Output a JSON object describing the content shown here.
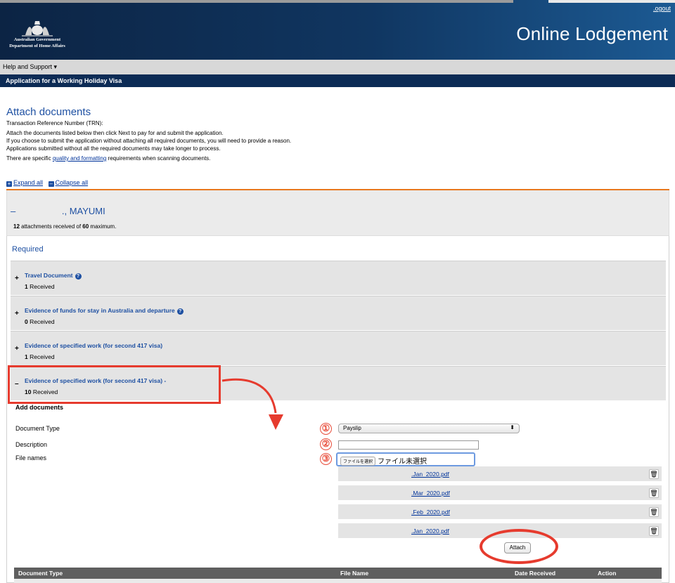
{
  "header": {
    "logout": ".ogout",
    "gov_line1": "Australian Government",
    "gov_line2": "Department of Home Affairs",
    "title": "Online Lodgement"
  },
  "help_menu": "Help and Support ▾",
  "app_bar": "Application for a Working Holiday Visa",
  "page": {
    "title": "Attach documents",
    "trn_label": "Transaction Reference Number (TRN):",
    "line1": "Attach the documents listed below then click Next to pay for and submit the application.",
    "line2": "If you choose to submit the application without attaching all required documents, you will need to provide a reason.",
    "line3": "Applications submitted without all the required documents may take longer to process.",
    "line4_pre": "There are specific ",
    "line4_link": "quality and formatting",
    "line4_post": " requirements when scanning documents.",
    "expand_all": "Expand all",
    "collapse_all": "Collapse all"
  },
  "applicant": {
    "toggle": "–",
    "name": "., MAYUMI",
    "count": "12",
    "count_text": " attachments received of ",
    "max": "60",
    "max_text": " maximum."
  },
  "required_title": "Required",
  "documents": [
    {
      "sign": "+",
      "title": "Travel Document",
      "count": "1",
      "received": "Received",
      "help": true
    },
    {
      "sign": "+",
      "title": "Evidence of funds for stay in Australia and departure",
      "count": "0",
      "received": "Received",
      "help": true
    },
    {
      "sign": "+",
      "title": "Evidence of specified work (for second 417 visa)",
      "count": "1",
      "received": "Received",
      "help": false
    },
    {
      "sign": "–",
      "title": "Evidence of specified work (for second 417 visa) -",
      "count": "10",
      "received": "Received",
      "help": false
    }
  ],
  "add_documents": {
    "heading": "Add documents",
    "document_type_label": "Document Type",
    "description_label": "Description",
    "file_names_label": "File names",
    "selected_type": "Payslip",
    "description_value": "",
    "file_button": "ファイルを選択",
    "file_status": "ファイル未選択",
    "markers": [
      "①",
      "②",
      "③"
    ],
    "files": [
      ".Jan_2020.pdf",
      ".Mar_2020.pdf",
      ".Feb_2020.pdf",
      ".Jan_2020.pdf"
    ],
    "attach_button": "Attach"
  },
  "table": {
    "col_type": "Document Type",
    "col_file": "File Name",
    "col_date": "Date Received",
    "col_action": "Action"
  },
  "colors": {
    "header_dark": "#0c2444",
    "link_blue": "#1e50a2",
    "accent_orange": "#e8781e",
    "annotation_red": "#e63b2e"
  }
}
